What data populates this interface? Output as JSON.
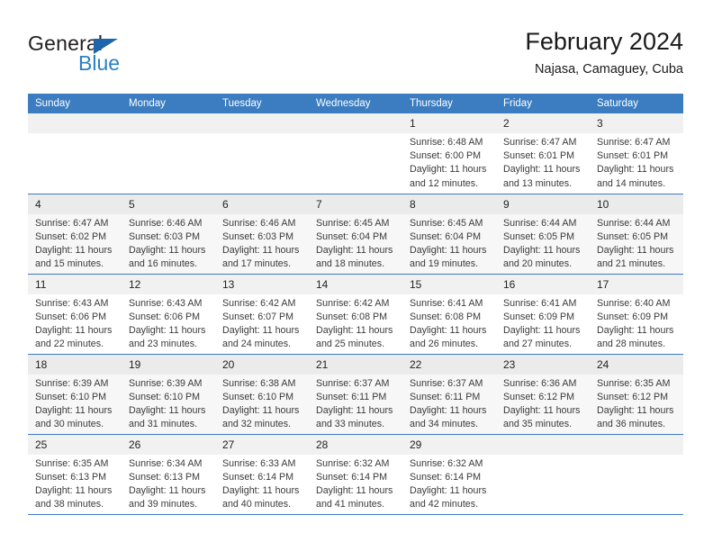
{
  "brand": {
    "name_dark": "General",
    "name_light": "Blue",
    "triangle_color": "#1e66ab",
    "blue_color": "#2b7fc3"
  },
  "header": {
    "title": "February 2024",
    "subtitle": "Najasa, Camaguey, Cuba"
  },
  "theme": {
    "header_blue": "#3b7dc0",
    "row_shade": "#f7f7f7",
    "daynum_band": "#f1f1f1"
  },
  "weekdays": [
    "Sunday",
    "Monday",
    "Tuesday",
    "Wednesday",
    "Thursday",
    "Friday",
    "Saturday"
  ],
  "weeks": [
    {
      "shaded": false,
      "days": [
        {
          "num": "",
          "lines": []
        },
        {
          "num": "",
          "lines": []
        },
        {
          "num": "",
          "lines": []
        },
        {
          "num": "",
          "lines": []
        },
        {
          "num": "1",
          "lines": [
            "Sunrise: 6:48 AM",
            "Sunset: 6:00 PM",
            "Daylight: 11 hours",
            "and 12 minutes."
          ]
        },
        {
          "num": "2",
          "lines": [
            "Sunrise: 6:47 AM",
            "Sunset: 6:01 PM",
            "Daylight: 11 hours",
            "and 13 minutes."
          ]
        },
        {
          "num": "3",
          "lines": [
            "Sunrise: 6:47 AM",
            "Sunset: 6:01 PM",
            "Daylight: 11 hours",
            "and 14 minutes."
          ]
        }
      ]
    },
    {
      "shaded": true,
      "days": [
        {
          "num": "4",
          "lines": [
            "Sunrise: 6:47 AM",
            "Sunset: 6:02 PM",
            "Daylight: 11 hours",
            "and 15 minutes."
          ]
        },
        {
          "num": "5",
          "lines": [
            "Sunrise: 6:46 AM",
            "Sunset: 6:03 PM",
            "Daylight: 11 hours",
            "and 16 minutes."
          ]
        },
        {
          "num": "6",
          "lines": [
            "Sunrise: 6:46 AM",
            "Sunset: 6:03 PM",
            "Daylight: 11 hours",
            "and 17 minutes."
          ]
        },
        {
          "num": "7",
          "lines": [
            "Sunrise: 6:45 AM",
            "Sunset: 6:04 PM",
            "Daylight: 11 hours",
            "and 18 minutes."
          ]
        },
        {
          "num": "8",
          "lines": [
            "Sunrise: 6:45 AM",
            "Sunset: 6:04 PM",
            "Daylight: 11 hours",
            "and 19 minutes."
          ]
        },
        {
          "num": "9",
          "lines": [
            "Sunrise: 6:44 AM",
            "Sunset: 6:05 PM",
            "Daylight: 11 hours",
            "and 20 minutes."
          ]
        },
        {
          "num": "10",
          "lines": [
            "Sunrise: 6:44 AM",
            "Sunset: 6:05 PM",
            "Daylight: 11 hours",
            "and 21 minutes."
          ]
        }
      ]
    },
    {
      "shaded": false,
      "days": [
        {
          "num": "11",
          "lines": [
            "Sunrise: 6:43 AM",
            "Sunset: 6:06 PM",
            "Daylight: 11 hours",
            "and 22 minutes."
          ]
        },
        {
          "num": "12",
          "lines": [
            "Sunrise: 6:43 AM",
            "Sunset: 6:06 PM",
            "Daylight: 11 hours",
            "and 23 minutes."
          ]
        },
        {
          "num": "13",
          "lines": [
            "Sunrise: 6:42 AM",
            "Sunset: 6:07 PM",
            "Daylight: 11 hours",
            "and 24 minutes."
          ]
        },
        {
          "num": "14",
          "lines": [
            "Sunrise: 6:42 AM",
            "Sunset: 6:08 PM",
            "Daylight: 11 hours",
            "and 25 minutes."
          ]
        },
        {
          "num": "15",
          "lines": [
            "Sunrise: 6:41 AM",
            "Sunset: 6:08 PM",
            "Daylight: 11 hours",
            "and 26 minutes."
          ]
        },
        {
          "num": "16",
          "lines": [
            "Sunrise: 6:41 AM",
            "Sunset: 6:09 PM",
            "Daylight: 11 hours",
            "and 27 minutes."
          ]
        },
        {
          "num": "17",
          "lines": [
            "Sunrise: 6:40 AM",
            "Sunset: 6:09 PM",
            "Daylight: 11 hours",
            "and 28 minutes."
          ]
        }
      ]
    },
    {
      "shaded": true,
      "days": [
        {
          "num": "18",
          "lines": [
            "Sunrise: 6:39 AM",
            "Sunset: 6:10 PM",
            "Daylight: 11 hours",
            "and 30 minutes."
          ]
        },
        {
          "num": "19",
          "lines": [
            "Sunrise: 6:39 AM",
            "Sunset: 6:10 PM",
            "Daylight: 11 hours",
            "and 31 minutes."
          ]
        },
        {
          "num": "20",
          "lines": [
            "Sunrise: 6:38 AM",
            "Sunset: 6:10 PM",
            "Daylight: 11 hours",
            "and 32 minutes."
          ]
        },
        {
          "num": "21",
          "lines": [
            "Sunrise: 6:37 AM",
            "Sunset: 6:11 PM",
            "Daylight: 11 hours",
            "and 33 minutes."
          ]
        },
        {
          "num": "22",
          "lines": [
            "Sunrise: 6:37 AM",
            "Sunset: 6:11 PM",
            "Daylight: 11 hours",
            "and 34 minutes."
          ]
        },
        {
          "num": "23",
          "lines": [
            "Sunrise: 6:36 AM",
            "Sunset: 6:12 PM",
            "Daylight: 11 hours",
            "and 35 minutes."
          ]
        },
        {
          "num": "24",
          "lines": [
            "Sunrise: 6:35 AM",
            "Sunset: 6:12 PM",
            "Daylight: 11 hours",
            "and 36 minutes."
          ]
        }
      ]
    },
    {
      "shaded": false,
      "days": [
        {
          "num": "25",
          "lines": [
            "Sunrise: 6:35 AM",
            "Sunset: 6:13 PM",
            "Daylight: 11 hours",
            "and 38 minutes."
          ]
        },
        {
          "num": "26",
          "lines": [
            "Sunrise: 6:34 AM",
            "Sunset: 6:13 PM",
            "Daylight: 11 hours",
            "and 39 minutes."
          ]
        },
        {
          "num": "27",
          "lines": [
            "Sunrise: 6:33 AM",
            "Sunset: 6:14 PM",
            "Daylight: 11 hours",
            "and 40 minutes."
          ]
        },
        {
          "num": "28",
          "lines": [
            "Sunrise: 6:32 AM",
            "Sunset: 6:14 PM",
            "Daylight: 11 hours",
            "and 41 minutes."
          ]
        },
        {
          "num": "29",
          "lines": [
            "Sunrise: 6:32 AM",
            "Sunset: 6:14 PM",
            "Daylight: 11 hours",
            "and 42 minutes."
          ]
        },
        {
          "num": "",
          "lines": []
        },
        {
          "num": "",
          "lines": []
        }
      ]
    }
  ]
}
